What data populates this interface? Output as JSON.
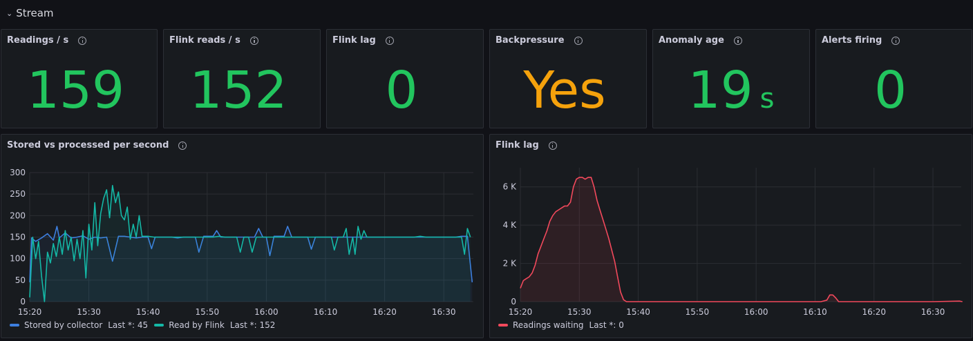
{
  "row": {
    "title": "Stream",
    "chevron": "⌄"
  },
  "stats": [
    {
      "title": "Readings / s",
      "value": "159",
      "unit": "",
      "color": "#22c55e"
    },
    {
      "title": "Flink reads / s",
      "value": "152",
      "unit": "",
      "color": "#22c55e"
    },
    {
      "title": "Flink lag",
      "value": "0",
      "unit": "",
      "color": "#22c55e"
    },
    {
      "title": "Backpressure",
      "value": "Yes",
      "unit": "",
      "color": "#f5a20c"
    },
    {
      "title": "Anomaly age",
      "value": "19",
      "unit": "s",
      "color": "#22c55e"
    },
    {
      "title": "Alerts firing",
      "value": "0",
      "unit": "",
      "color": "#22c55e"
    }
  ],
  "charts": {
    "stored": {
      "title": "Stored vs processed per second",
      "legend": [
        {
          "name": "Stored by collector",
          "last": "Last *: 45",
          "color": "#3d7fdf"
        },
        {
          "name": "Read by Flink",
          "last": "Last *: 152",
          "color": "#14b8a6"
        }
      ]
    },
    "lag": {
      "title": "Flink lag",
      "legend": [
        {
          "name": "Readings waiting",
          "last": "Last *: 0",
          "color": "#f2495c"
        }
      ]
    }
  },
  "chart_data": [
    {
      "type": "line",
      "title": "Stored vs processed per second",
      "x_unit": "minutes from 15:20",
      "xticks": [
        "15:20",
        "15:30",
        "15:40",
        "15:50",
        "16:00",
        "16:10",
        "16:20",
        "16:30"
      ],
      "ylim": [
        0,
        300
      ],
      "yticks": [
        "0",
        "50",
        "100",
        "150",
        "200",
        "250",
        "300"
      ],
      "grid": true,
      "legend_position": "bottom-left",
      "series": [
        {
          "name": "Stored by collector",
          "color": "#3d7fdf",
          "points": [
            [
              0,
              45
            ],
            [
              0.3,
              148
            ],
            [
              1,
              140
            ],
            [
              2,
              148
            ],
            [
              3,
              158
            ],
            [
              4,
              143
            ],
            [
              4.6,
              175
            ],
            [
              5,
              148
            ],
            [
              6,
              160
            ],
            [
              7,
              148
            ],
            [
              8,
              150
            ],
            [
              9,
              153
            ],
            [
              10,
              145
            ],
            [
              11,
              150
            ],
            [
              12,
              148
            ],
            [
              13,
              150
            ],
            [
              14,
              94
            ],
            [
              15,
              152
            ],
            [
              16,
              152
            ],
            [
              17,
              150
            ],
            [
              18,
              148
            ],
            [
              19,
              150
            ],
            [
              20,
              150
            ],
            [
              20.6,
              123
            ],
            [
              21.2,
              150
            ],
            [
              22,
              150
            ],
            [
              23,
              150
            ],
            [
              24,
              150
            ],
            [
              25,
              148
            ],
            [
              26,
              150
            ],
            [
              27,
              150
            ],
            [
              28,
              150
            ],
            [
              28.6,
              115
            ],
            [
              29.4,
              152
            ],
            [
              30,
              152
            ],
            [
              31,
              152
            ],
            [
              31.6,
              165
            ],
            [
              32.3,
              150
            ],
            [
              33,
              150
            ],
            [
              34,
              150
            ],
            [
              35,
              150
            ],
            [
              36,
              150
            ],
            [
              37,
              150
            ],
            [
              38,
              150
            ],
            [
              38.7,
              170
            ],
            [
              39.4,
              150
            ],
            [
              40,
              150
            ],
            [
              40.6,
              107
            ],
            [
              41.3,
              152
            ],
            [
              42,
              152
            ],
            [
              43,
              152
            ],
            [
              43.6,
              175
            ],
            [
              44.3,
              150
            ],
            [
              45,
              150
            ],
            [
              46,
              150
            ],
            [
              47,
              150
            ],
            [
              47.6,
              122
            ],
            [
              48.3,
              150
            ],
            [
              49,
              150
            ],
            [
              50,
              150
            ],
            [
              51,
              150
            ],
            [
              52,
              150
            ],
            [
              53,
              150
            ],
            [
              54,
              150
            ],
            [
              55,
              150
            ],
            [
              56,
              150
            ],
            [
              57,
              150
            ],
            [
              58,
              150
            ],
            [
              59,
              150
            ],
            [
              60,
              150
            ],
            [
              61,
              150
            ],
            [
              62,
              150
            ],
            [
              63,
              150
            ],
            [
              64,
              150
            ],
            [
              65,
              150
            ],
            [
              66,
              150
            ],
            [
              67,
              150
            ],
            [
              68,
              150
            ],
            [
              69,
              150
            ],
            [
              70,
              150
            ],
            [
              71,
              150
            ],
            [
              72,
              150
            ],
            [
              73,
              152
            ],
            [
              74,
              152
            ],
            [
              74.8,
              45
            ]
          ]
        },
        {
          "name": "Read by Flink",
          "color": "#14b8a6",
          "points": [
            [
              0,
              10
            ],
            [
              0.5,
              150
            ],
            [
              1,
              100
            ],
            [
              1.5,
              140
            ],
            [
              2,
              60
            ],
            [
              2.5,
              0
            ],
            [
              3,
              115
            ],
            [
              3.5,
              90
            ],
            [
              4,
              135
            ],
            [
              4.5,
              105
            ],
            [
              5,
              150
            ],
            [
              5.5,
              110
            ],
            [
              6,
              165
            ],
            [
              6.5,
              120
            ],
            [
              7,
              150
            ],
            [
              7.5,
              95
            ],
            [
              8,
              145
            ],
            [
              8.5,
              100
            ],
            [
              9,
              165
            ],
            [
              9.5,
              55
            ],
            [
              10,
              180
            ],
            [
              10.5,
              120
            ],
            [
              11,
              230
            ],
            [
              11.5,
              130
            ],
            [
              12,
              205
            ],
            [
              12.5,
              240
            ],
            [
              13,
              260
            ],
            [
              13.5,
              195
            ],
            [
              14,
              270
            ],
            [
              14.5,
              230
            ],
            [
              15,
              255
            ],
            [
              15.5,
              200
            ],
            [
              16,
              190
            ],
            [
              16.5,
              220
            ],
            [
              17,
              145
            ],
            [
              17.5,
              180
            ],
            [
              18,
              150
            ],
            [
              18.5,
              200
            ],
            [
              19,
              152
            ],
            [
              20,
              152
            ],
            [
              21,
              150
            ],
            [
              22,
              150
            ],
            [
              23,
              150
            ],
            [
              24,
              150
            ],
            [
              25,
              150
            ],
            [
              26,
              150
            ],
            [
              27,
              150
            ],
            [
              28,
              150
            ],
            [
              29,
              150
            ],
            [
              30,
              150
            ],
            [
              31,
              150
            ],
            [
              32,
              152
            ],
            [
              33,
              150
            ],
            [
              34,
              150
            ],
            [
              35,
              150
            ],
            [
              35.6,
              115
            ],
            [
              36.2,
              150
            ],
            [
              37,
              150
            ],
            [
              37.6,
              115
            ],
            [
              38.3,
              150
            ],
            [
              39,
              150
            ],
            [
              40,
              150
            ],
            [
              41,
              150
            ],
            [
              42,
              150
            ],
            [
              43,
              150
            ],
            [
              44,
              150
            ],
            [
              45,
              150
            ],
            [
              46,
              150
            ],
            [
              47,
              150
            ],
            [
              48,
              150
            ],
            [
              49,
              150
            ],
            [
              50,
              150
            ],
            [
              51,
              150
            ],
            [
              51.5,
              120
            ],
            [
              52.1,
              150
            ],
            [
              53,
              150
            ],
            [
              53.5,
              170
            ],
            [
              54,
              110
            ],
            [
              54.6,
              150
            ],
            [
              55,
              110
            ],
            [
              55.5,
              175
            ],
            [
              56,
              145
            ],
            [
              56.5,
              165
            ],
            [
              57,
              150
            ],
            [
              58,
              150
            ],
            [
              59,
              150
            ],
            [
              60,
              150
            ],
            [
              61,
              150
            ],
            [
              62,
              150
            ],
            [
              63,
              150
            ],
            [
              64,
              150
            ],
            [
              65,
              150
            ],
            [
              66,
              152
            ],
            [
              67,
              150
            ],
            [
              68,
              150
            ],
            [
              69,
              150
            ],
            [
              70,
              150
            ],
            [
              71,
              150
            ],
            [
              72,
              150
            ],
            [
              73,
              150
            ],
            [
              73.5,
              110
            ],
            [
              74,
              170
            ],
            [
              74.5,
              150
            ]
          ]
        }
      ]
    },
    {
      "type": "area",
      "title": "Flink lag",
      "x_unit": "minutes from 15:20",
      "xticks": [
        "15:20",
        "15:30",
        "15:40",
        "15:50",
        "16:00",
        "16:10",
        "16:20",
        "16:30"
      ],
      "ylim": [
        0,
        7000
      ],
      "yticks": [
        "0",
        "2 K",
        "4 K",
        "6 K"
      ],
      "grid": true,
      "legend_position": "bottom-left",
      "series": [
        {
          "name": "Readings waiting",
          "color": "#f2495c",
          "points": [
            [
              0,
              700
            ],
            [
              0.5,
              1100
            ],
            [
              1,
              1200
            ],
            [
              1.5,
              1300
            ],
            [
              2,
              1500
            ],
            [
              2.5,
              1900
            ],
            [
              3,
              2500
            ],
            [
              3.5,
              2900
            ],
            [
              4,
              3300
            ],
            [
              4.5,
              3700
            ],
            [
              5,
              4200
            ],
            [
              5.5,
              4500
            ],
            [
              6,
              4700
            ],
            [
              6.5,
              4800
            ],
            [
              7,
              4900
            ],
            [
              7.5,
              5000
            ],
            [
              8,
              5000
            ],
            [
              8.5,
              5200
            ],
            [
              9,
              6000
            ],
            [
              9.5,
              6400
            ],
            [
              10,
              6500
            ],
            [
              10.5,
              6500
            ],
            [
              11,
              6400
            ],
            [
              11.5,
              6500
            ],
            [
              12,
              6500
            ],
            [
              12.5,
              6000
            ],
            [
              13,
              5300
            ],
            [
              13.5,
              4800
            ],
            [
              14,
              4300
            ],
            [
              14.5,
              3800
            ],
            [
              15,
              3300
            ],
            [
              15.5,
              2700
            ],
            [
              16,
              2100
            ],
            [
              16.5,
              1300
            ],
            [
              17,
              500
            ],
            [
              17.5,
              100
            ],
            [
              18,
              0
            ],
            [
              20,
              0
            ],
            [
              30,
              0
            ],
            [
              40,
              0
            ],
            [
              50,
              0
            ],
            [
              51,
              0
            ],
            [
              52,
              80
            ],
            [
              52.5,
              350
            ],
            [
              53,
              350
            ],
            [
              53.5,
              200
            ],
            [
              54,
              0
            ],
            [
              60,
              0
            ],
            [
              70,
              0
            ],
            [
              74.5,
              30
            ],
            [
              75,
              0
            ]
          ]
        }
      ]
    }
  ]
}
